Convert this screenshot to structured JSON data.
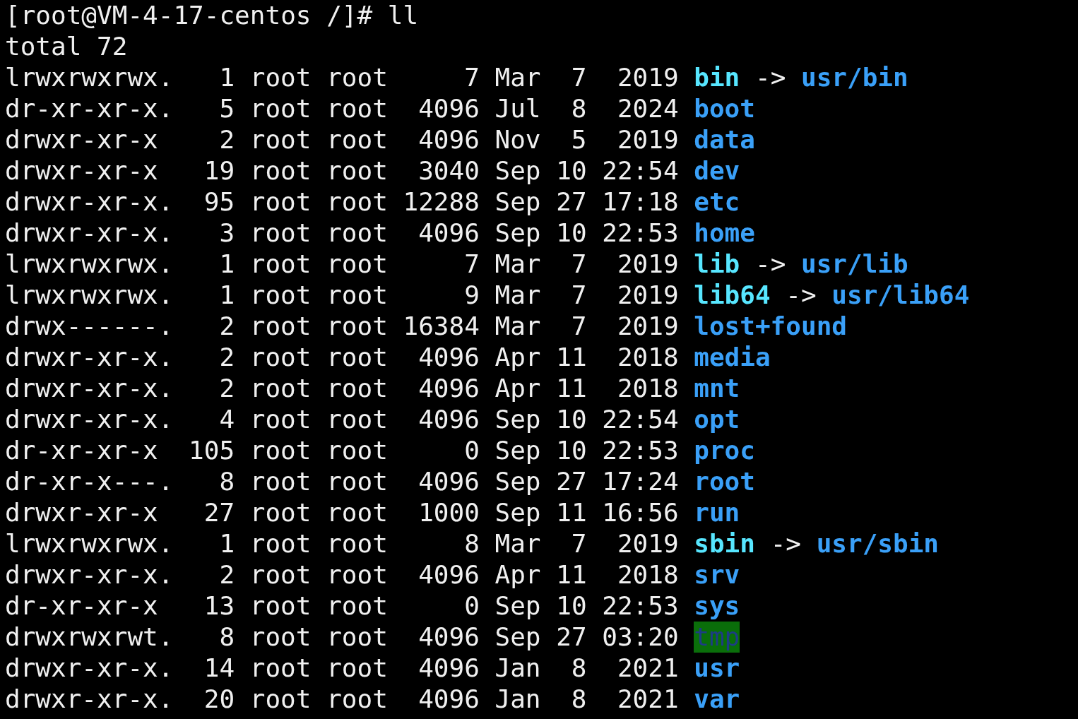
{
  "prompt": "[root@VM-4-17-centos /]# ll",
  "total": "total 72",
  "entries": [
    {
      "perms": "lrwxrwxrwx.",
      "links": "1",
      "owner": "root",
      "group": "root",
      "size": "7",
      "month": "Mar",
      "day": "7",
      "time": "2019",
      "name": "bin",
      "kind": "link",
      "arrow": "->",
      "target": "usr/bin"
    },
    {
      "perms": "dr-xr-xr-x.",
      "links": "5",
      "owner": "root",
      "group": "root",
      "size": "4096",
      "month": "Jul",
      "day": "8",
      "time": "2024",
      "name": "boot",
      "kind": "dir"
    },
    {
      "perms": "drwxr-xr-x",
      "links": "2",
      "owner": "root",
      "group": "root",
      "size": "4096",
      "month": "Nov",
      "day": "5",
      "time": "2019",
      "name": "data",
      "kind": "dir"
    },
    {
      "perms": "drwxr-xr-x",
      "links": "19",
      "owner": "root",
      "group": "root",
      "size": "3040",
      "month": "Sep",
      "day": "10",
      "time": "22:54",
      "name": "dev",
      "kind": "dir"
    },
    {
      "perms": "drwxr-xr-x.",
      "links": "95",
      "owner": "root",
      "group": "root",
      "size": "12288",
      "month": "Sep",
      "day": "27",
      "time": "17:18",
      "name": "etc",
      "kind": "dir"
    },
    {
      "perms": "drwxr-xr-x.",
      "links": "3",
      "owner": "root",
      "group": "root",
      "size": "4096",
      "month": "Sep",
      "day": "10",
      "time": "22:53",
      "name": "home",
      "kind": "dir"
    },
    {
      "perms": "lrwxrwxrwx.",
      "links": "1",
      "owner": "root",
      "group": "root",
      "size": "7",
      "month": "Mar",
      "day": "7",
      "time": "2019",
      "name": "lib",
      "kind": "link",
      "arrow": "->",
      "target": "usr/lib"
    },
    {
      "perms": "lrwxrwxrwx.",
      "links": "1",
      "owner": "root",
      "group": "root",
      "size": "9",
      "month": "Mar",
      "day": "7",
      "time": "2019",
      "name": "lib64",
      "kind": "link",
      "arrow": "->",
      "target": "usr/lib64"
    },
    {
      "perms": "drwx------.",
      "links": "2",
      "owner": "root",
      "group": "root",
      "size": "16384",
      "month": "Mar",
      "day": "7",
      "time": "2019",
      "name": "lost+found",
      "kind": "dir"
    },
    {
      "perms": "drwxr-xr-x.",
      "links": "2",
      "owner": "root",
      "group": "root",
      "size": "4096",
      "month": "Apr",
      "day": "11",
      "time": "2018",
      "name": "media",
      "kind": "dir"
    },
    {
      "perms": "drwxr-xr-x.",
      "links": "2",
      "owner": "root",
      "group": "root",
      "size": "4096",
      "month": "Apr",
      "day": "11",
      "time": "2018",
      "name": "mnt",
      "kind": "dir"
    },
    {
      "perms": "drwxr-xr-x.",
      "links": "4",
      "owner": "root",
      "group": "root",
      "size": "4096",
      "month": "Sep",
      "day": "10",
      "time": "22:54",
      "name": "opt",
      "kind": "dir"
    },
    {
      "perms": "dr-xr-xr-x",
      "links": "105",
      "owner": "root",
      "group": "root",
      "size": "0",
      "month": "Sep",
      "day": "10",
      "time": "22:53",
      "name": "proc",
      "kind": "dir"
    },
    {
      "perms": "dr-xr-x---.",
      "links": "8",
      "owner": "root",
      "group": "root",
      "size": "4096",
      "month": "Sep",
      "day": "27",
      "time": "17:24",
      "name": "root",
      "kind": "dir"
    },
    {
      "perms": "drwxr-xr-x",
      "links": "27",
      "owner": "root",
      "group": "root",
      "size": "1000",
      "month": "Sep",
      "day": "11",
      "time": "16:56",
      "name": "run",
      "kind": "dir"
    },
    {
      "perms": "lrwxrwxrwx.",
      "links": "1",
      "owner": "root",
      "group": "root",
      "size": "8",
      "month": "Mar",
      "day": "7",
      "time": "2019",
      "name": "sbin",
      "kind": "link",
      "arrow": "->",
      "target": "usr/sbin"
    },
    {
      "perms": "drwxr-xr-x.",
      "links": "2",
      "owner": "root",
      "group": "root",
      "size": "4096",
      "month": "Apr",
      "day": "11",
      "time": "2018",
      "name": "srv",
      "kind": "dir"
    },
    {
      "perms": "dr-xr-xr-x",
      "links": "13",
      "owner": "root",
      "group": "root",
      "size": "0",
      "month": "Sep",
      "day": "10",
      "time": "22:53",
      "name": "sys",
      "kind": "dir"
    },
    {
      "perms": "drwxrwxrwt.",
      "links": "8",
      "owner": "root",
      "group": "root",
      "size": "4096",
      "month": "Sep",
      "day": "27",
      "time": "03:20",
      "name": "tmp",
      "kind": "sticky"
    },
    {
      "perms": "drwxr-xr-x.",
      "links": "14",
      "owner": "root",
      "group": "root",
      "size": "4096",
      "month": "Jan",
      "day": "8",
      "time": "2021",
      "name": "usr",
      "kind": "dir"
    },
    {
      "perms": "drwxr-xr-x.",
      "links": "20",
      "owner": "root",
      "group": "root",
      "size": "4096",
      "month": "Jan",
      "day": "8",
      "time": "2021",
      "name": "var",
      "kind": "dir"
    }
  ]
}
